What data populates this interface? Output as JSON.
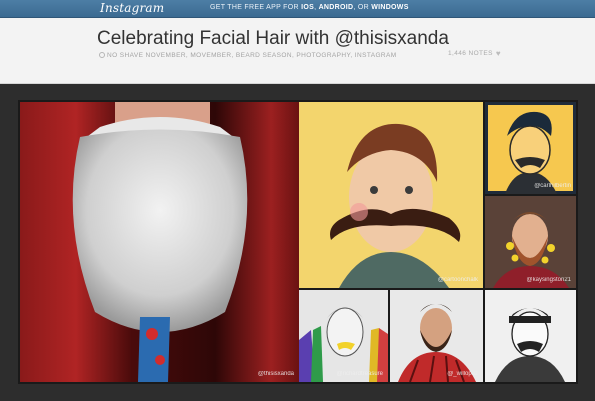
{
  "topbar": {
    "logo": "Instagram",
    "app_prefix": "GET THE FREE APP FOR ",
    "app_ios": "IOS",
    "app_sep1": ", ",
    "app_android": "ANDROID",
    "app_sep2": ", OR ",
    "app_windows": "WINDOWS"
  },
  "header": {
    "title": "Celebrating Facial Hair with @thisisxanda",
    "tags": "NO SHAVE NOVEMBER, MOVEMBER, BEARD SEASON, PHOTOGRAPHY, INSTAGRAM",
    "notes": "1,446 NOTES"
  },
  "credits": {
    "main": "@thisisxanda",
    "art": "@cartoonchalk",
    "sm1": "@carlhilbertin",
    "sm2": "@kaysingston21",
    "b1": "@richardtreasure",
    "b2": "@_willopaz",
    "b3": ""
  },
  "colors": {
    "topbar": "#3f6e95",
    "header_bg": "#f3f3f3",
    "page_bg": "#2d2d2d"
  },
  "icons": [
    "tag-icon",
    "heart-icon"
  ]
}
